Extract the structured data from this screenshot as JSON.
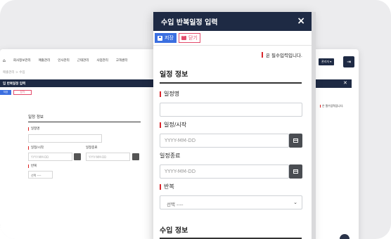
{
  "background_app": {
    "nav_items": [
      "회사정보관리",
      "매출관리",
      "인사관리",
      "근태관리",
      "사업관리",
      "고객센터"
    ],
    "breadcrumb": "매출관리 > 수입",
    "modal_title": "입 반복일정 입력",
    "save_label": "저장",
    "close_label": "닫기",
    "section_title": "일정 정보",
    "field_name_label": "일정명",
    "field_start_label": "일정/시작",
    "field_end_label": "일정종료",
    "date_placeholder": "YYYY-MM-DD",
    "repeat_label": "반복",
    "repeat_value": "선택 ----",
    "required_note": "은 필수입력입니다.",
    "user_button": "관리자 ▾"
  },
  "modal": {
    "title": "수입 반복일정 입력",
    "close_icon": "×",
    "toolbar": {
      "save_label": "저장",
      "close_label": "닫기"
    },
    "required_note": "은 필수입력입니다.",
    "section_schedule": "일정 정보",
    "fields": {
      "name_label": "일정명",
      "name_value": "",
      "start_label": "일정/시작",
      "start_placeholder": "YYYY-MM-DD",
      "end_label": "일정종료",
      "end_placeholder": "YYYY-MM-DD",
      "repeat_label": "반복",
      "repeat_value": "선택 ----"
    },
    "section_income": "수입 정보"
  },
  "colors": {
    "header_navy": "#1e2a44",
    "save_blue": "#3b6fe0",
    "close_pink": "#e34b6b",
    "required_red": "#d9262c"
  },
  "icons": {
    "save": "disk-icon",
    "close_button": "x-box-icon",
    "calendar": "calendar-icon",
    "chevron": "chevron-down-icon",
    "modal_close": "close-icon"
  }
}
